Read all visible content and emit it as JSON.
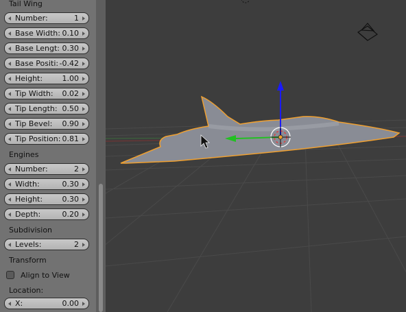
{
  "sections": {
    "tail_wing": "Tail Wing",
    "engines": "Engines",
    "subdivision": "Subdivision",
    "transform": "Transform",
    "location": "Location:"
  },
  "tail_wing_fields": [
    {
      "label": "Number:",
      "value": "1"
    },
    {
      "label": "Base Width:",
      "value": "0.10"
    },
    {
      "label": "Base Lengt:",
      "value": "0.30"
    },
    {
      "label": "Base Positi:",
      "value": "-0.42"
    },
    {
      "label": "Height:",
      "value": "1.00"
    },
    {
      "label": "Tip Width:",
      "value": "0.02"
    },
    {
      "label": "Tip Length:",
      "value": "0.50"
    },
    {
      "label": "Tip Bevel:",
      "value": "0.90"
    },
    {
      "label": "Tip Position:",
      "value": "0.81"
    }
  ],
  "engines_fields": [
    {
      "label": "Number:",
      "value": "2"
    },
    {
      "label": "Width:",
      "value": "0.30"
    },
    {
      "label": "Height:",
      "value": "0.30"
    },
    {
      "label": "Depth:",
      "value": "0.20"
    }
  ],
  "subdivision_fields": [
    {
      "label": "Levels:",
      "value": "2"
    }
  ],
  "align_to_view": {
    "label": "Align to View",
    "checked": false
  },
  "location_fields": [
    {
      "label": "X:",
      "value": "0.00"
    }
  ],
  "viewport": {
    "background": "#3d3d3d",
    "mesh_fill": "#8a8d96",
    "selection_outline": "#f0a030",
    "axis_z_color": "#1a1aff",
    "axis_y_color": "#22c022",
    "grid_x_color": "#7a3333"
  }
}
